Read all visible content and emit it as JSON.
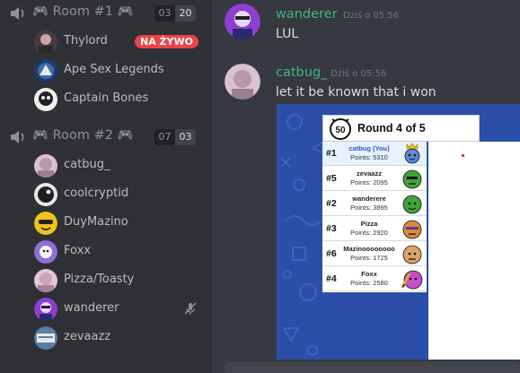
{
  "rooms": [
    {
      "title": "Room #1",
      "icon": "gamepad-icon",
      "count_current": "03",
      "count_max": "20",
      "members": [
        {
          "name": "Thylord",
          "live_badge": "NA ŻYWO",
          "avatar_color": "#7a5c6e"
        },
        {
          "name": "Ape Sex Legends",
          "avatar_color": "#3b6ea8"
        },
        {
          "name": "Captain Bones",
          "avatar_color": "#e8e8e8"
        }
      ]
    },
    {
      "title": "Room #2",
      "icon": "gamepad-icon",
      "count_current": "07",
      "count_max": "03",
      "members": [
        {
          "name": "catbug_",
          "avatar_color": "#b79aa9"
        },
        {
          "name": "coolcryptid",
          "avatar_color": "#1e1e1e"
        },
        {
          "name": "DuyMazino",
          "avatar_color": "#f0c419"
        },
        {
          "name": "Foxx",
          "avatar_color": "#8f6ed5"
        },
        {
          "name": "Pizza/Toasty",
          "avatar_color": "#c9a3b8"
        },
        {
          "name": "wanderer",
          "avatar_color": "#8e3fd1",
          "muted": true
        },
        {
          "name": "zevaazz",
          "avatar_color": "#5a7fa8"
        }
      ]
    }
  ],
  "messages": [
    {
      "author": "wanderer",
      "time": "Dziś o 05:56",
      "text": "LUL",
      "avatar_color": "#8e3fd1"
    },
    {
      "author": "catbug_",
      "time": "Dziś o 05:56",
      "text": "let it be known that i won",
      "avatar_color": "#b79aa9"
    }
  ],
  "game": {
    "round_label": "Round 4 of 5",
    "timer": "50",
    "players": [
      {
        "rank": "#1",
        "name": "catbug (You)",
        "points": "Points: 5310",
        "face_color": "#5a8ad8",
        "is_me": true,
        "crown": true
      },
      {
        "rank": "#5",
        "name": "zevaazz",
        "points": "Points: 2095",
        "face_color": "#3fa53a"
      },
      {
        "rank": "#2",
        "name": "wanderere",
        "points": "Points: 3895",
        "face_color": "#3fa53a"
      },
      {
        "rank": "#3",
        "name": "Pizza",
        "points": "Points: 2920",
        "face_color": "#d98a3a"
      },
      {
        "rank": "#6",
        "name": "Mazinoooooooo",
        "points": "Points: 1725",
        "face_color": "#d9a36b"
      },
      {
        "rank": "#4",
        "name": "Foxx",
        "points": "Points: 2580",
        "face_color": "#c94fc9",
        "drawing": true
      }
    ]
  },
  "colors": {
    "author": "#43b581",
    "live": "#ed4245",
    "game_bg": "#2b4fa8"
  }
}
